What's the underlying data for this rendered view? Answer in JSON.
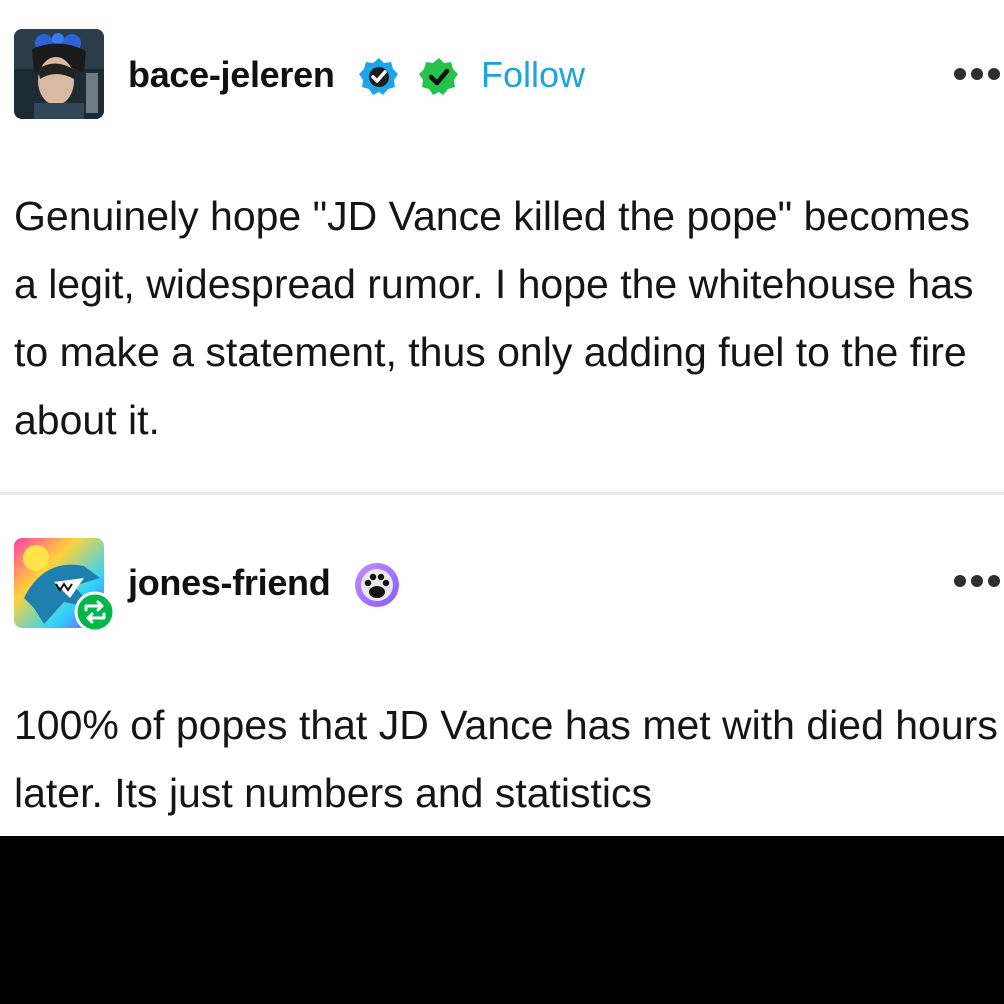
{
  "posts": [
    {
      "username": "bace-jeleren",
      "badges": [
        "blue-verified-check-icon",
        "green-verified-check-icon"
      ],
      "follow_label": "Follow",
      "text": "Genuinely hope \"JD Vance killed the pope\" becomes a legit, widespread rumor. I hope the whitehouse has to make a statement, thus only adding fuel to the fire about it."
    },
    {
      "username": "jones-friend",
      "badges": [
        "paw-print-badge-icon"
      ],
      "reblog_icon": "reblog-icon",
      "text": "100% of popes that JD Vance has met with died hours later. Its just numbers and statistics"
    }
  ],
  "colors": {
    "follow": "#1fa3d9",
    "verified_blue": "#1ea4ea",
    "verified_green": "#27c24c",
    "reblog_green": "#00b849",
    "text": "#151515"
  }
}
